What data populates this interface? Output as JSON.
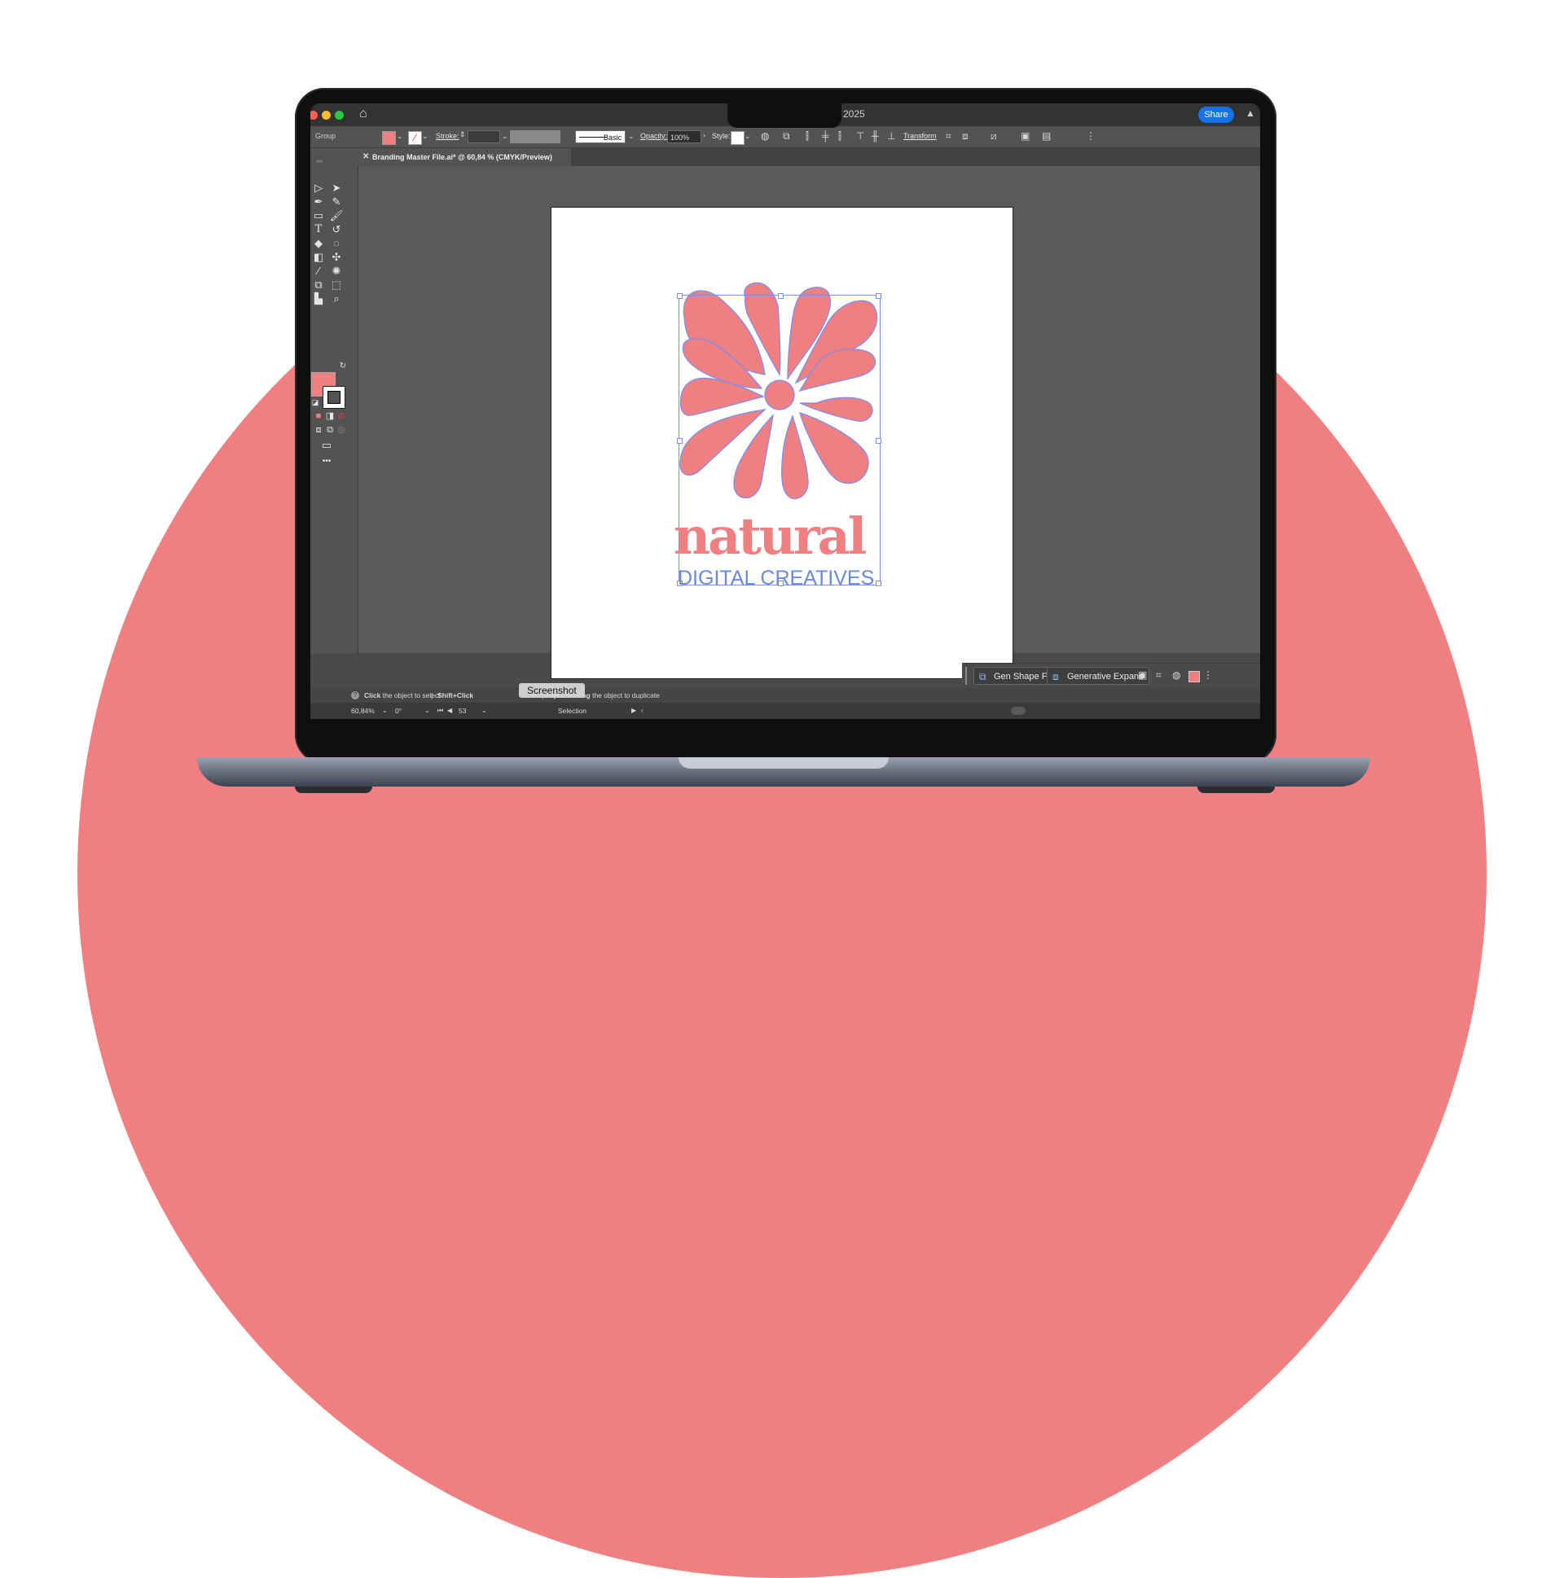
{
  "menubar": {
    "year_fragment": "2025",
    "share_label": "Share",
    "home_icon": "home-icon",
    "bell_icon": "bell-icon",
    "traffic_colors": [
      "#ff5f57",
      "#febc2e",
      "#28c840"
    ]
  },
  "controlbar": {
    "selection_type": "Group",
    "fill_color": "#f07f82",
    "stroke_label": "Stroke:",
    "brush_label": "Basic",
    "opacity_label": "Opacity:",
    "opacity_value": "100%",
    "style_label": "Style:",
    "transform_label": "Transform"
  },
  "document": {
    "tab_title": "Branding Master File.ai* @ 60,84 % (CMYK/Preview)",
    "close_icon": "close-icon"
  },
  "artwork": {
    "logo_word": "natural",
    "tagline": "DIGITAL CREATIVES",
    "primary_color": "#f07f82",
    "accent_color": "#6a8ae0"
  },
  "tools": {
    "more_label": "•••"
  },
  "ai_bar": {
    "gen_shape_fill_label": "Gen Shape Fill",
    "generative_expand_label": "Generative Expand"
  },
  "hints": {
    "click_bold": "Click",
    "click_text": "the object to select",
    "shift_click_bold": "Shift+Click",
    "option_drag_bold": "Option+Drag",
    "option_drag_text": "the object to duplicate",
    "partial_word": "ect"
  },
  "statusbar": {
    "zoom": "60,84%",
    "rotation": "0°",
    "artboard_number": "53",
    "tool_name": "Selection"
  },
  "tooltip": {
    "text": "Screenshot"
  }
}
